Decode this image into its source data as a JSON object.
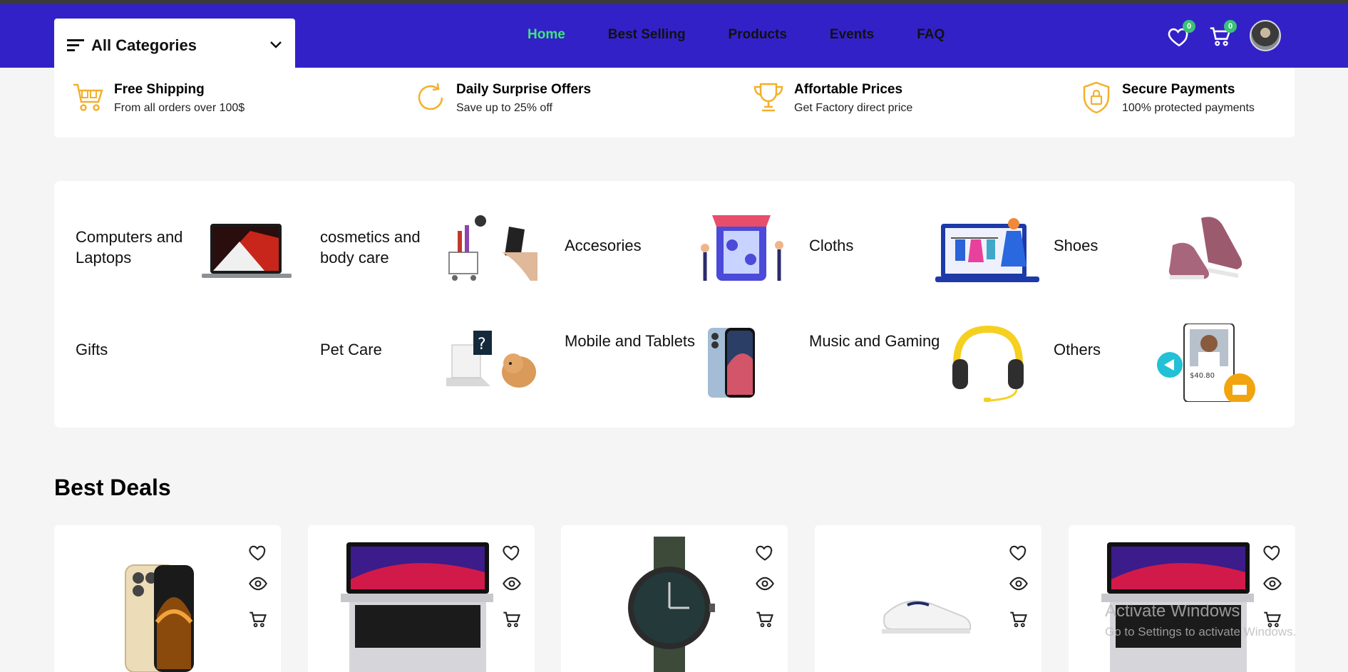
{
  "navbar": {
    "category_dropdown": "All Categories",
    "links": [
      "Home",
      "Best Selling",
      "Products",
      "Events",
      "FAQ"
    ],
    "active_link": "Home",
    "wishlist_count": "0",
    "cart_count": "0",
    "accent_color": "#3321c8",
    "active_color": "#3ee57b"
  },
  "features": [
    {
      "title": "Free Shipping",
      "subtitle": "From all orders over 100$",
      "icon": "cart-icon"
    },
    {
      "title": "Daily Surprise Offers",
      "subtitle": "Save up to 25% off",
      "icon": "refresh-icon"
    },
    {
      "title": "Affortable Prices",
      "subtitle": "Get Factory direct price",
      "icon": "trophy-icon"
    },
    {
      "title": "Secure Payments",
      "subtitle": "100% protected payments",
      "icon": "shield-lock-icon"
    }
  ],
  "categories": [
    {
      "name": "Computers and Laptops"
    },
    {
      "name": "cosmetics and body care"
    },
    {
      "name": "Accesories"
    },
    {
      "name": "Cloths"
    },
    {
      "name": "Shoes"
    },
    {
      "name": "Gifts"
    },
    {
      "name": "Pet Care"
    },
    {
      "name": "Mobile and Tablets"
    },
    {
      "name": "Music and Gaming"
    },
    {
      "name": "Others"
    }
  ],
  "best_deals": {
    "title": "Best Deals",
    "products": [
      "iphone",
      "macbook",
      "watch",
      "sneaker",
      "macbook"
    ]
  },
  "watermark": {
    "line1": "Activate Windows",
    "line2": "Go to Settings to activate Windows."
  }
}
